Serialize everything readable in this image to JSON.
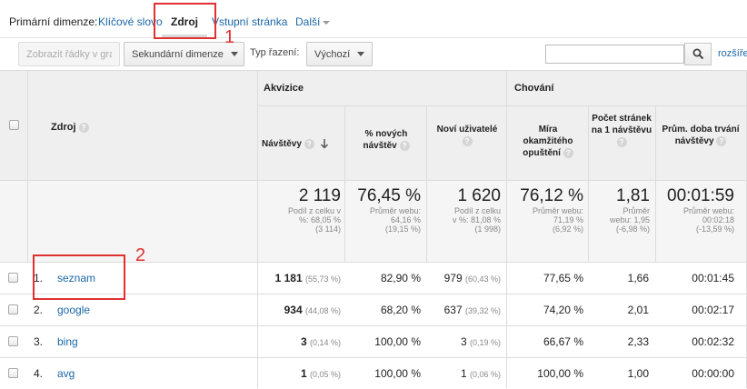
{
  "primary_dimension": {
    "label": "Primární dimenze:",
    "options": [
      "Klíčové slovo",
      "Zdroj",
      "Vstupní stránka"
    ],
    "active": "Zdroj",
    "more": "Další"
  },
  "toolbar": {
    "show_rows": "Zobrazit řádky v grafu",
    "secondary_dimension": "Sekundární dimenze",
    "sort_label": "Typ řazení:",
    "sort_value": "Výchozí",
    "search_value": "",
    "advanced": "rozšířené"
  },
  "table": {
    "dimension_header": "Zdroj",
    "groups": {
      "acquisition": "Akvizice",
      "behavior": "Chování"
    },
    "columns": [
      "Návštěvy",
      "% nových návštěv",
      "Noví uživatelé",
      "Míra okamžitého opuštění",
      "Počet stránek na 1 návštěvu",
      "Prům. doba trvání návštěvy"
    ],
    "summary": [
      {
        "value": "2 119",
        "lines": [
          "Podíl z celku v",
          "%: 68,05 %",
          "(3 114)"
        ]
      },
      {
        "value": "76,45 %",
        "lines": [
          "Průměr webu:",
          "64,16 %",
          "(19,15 %)"
        ]
      },
      {
        "value": "1 620",
        "lines": [
          "Podíl z celku",
          "v %: 81,08 %",
          "(1 998)"
        ]
      },
      {
        "value": "76,12 %",
        "lines": [
          "Průměr webu:",
          "71,19 %",
          "(6,92 %)"
        ]
      },
      {
        "value": "1,81",
        "lines": [
          "Průměr",
          "webu: 1,95",
          "(-6,98 %)"
        ]
      },
      {
        "value": "00:01:59",
        "lines": [
          "Průměr webu:",
          "00:02:18",
          "(-13,59 %)"
        ]
      }
    ],
    "rows": [
      {
        "num": "1.",
        "source": "seznam",
        "visits": "1 181",
        "visits_pct": "(55,73 %)",
        "new_pct": "82,90 %",
        "new_users": "979",
        "new_users_pct": "(60,43 %)",
        "bounce": "77,65 %",
        "pages": "1,66",
        "duration": "00:01:45"
      },
      {
        "num": "2.",
        "source": "google",
        "visits": "934",
        "visits_pct": "(44,08 %)",
        "new_pct": "68,20 %",
        "new_users": "637",
        "new_users_pct": "(39,32 %)",
        "bounce": "74,20 %",
        "pages": "2,01",
        "duration": "00:02:17"
      },
      {
        "num": "3.",
        "source": "bing",
        "visits": "3",
        "visits_pct": "(0,14 %)",
        "new_pct": "100,00 %",
        "new_users": "3",
        "new_users_pct": "(0,19 %)",
        "bounce": "66,67 %",
        "pages": "2,33",
        "duration": "00:02:32"
      },
      {
        "num": "4.",
        "source": "avg",
        "visits": "1",
        "visits_pct": "(0,05 %)",
        "new_pct": "100,00 %",
        "new_users": "1",
        "new_users_pct": "(0,06 %)",
        "bounce": "100,00 %",
        "pages": "1,00",
        "duration": "00:00:00"
      }
    ]
  },
  "annotations": {
    "one": "1",
    "two": "2"
  },
  "colors": {
    "link": "#1a66a6",
    "annotation": "#e03030"
  }
}
